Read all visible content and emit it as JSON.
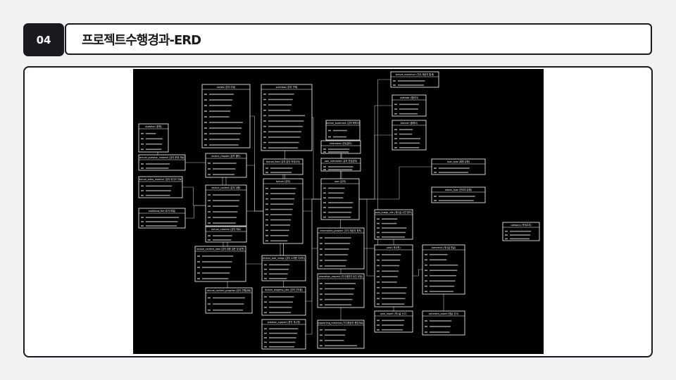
{
  "section_number": "04",
  "title": "프로젝트수행경과-ERD",
  "colors": {
    "number_box": "#1b1b1f",
    "frame_border": "#1b1b1f",
    "diagram_background": "#000000",
    "diagram_lines": "#ffffff"
  },
  "erd": {
    "entities": [
      "question (문제)",
      "lecture_question_material (강의 문제 자료)",
      "lecture_video_material (강의 비디오 자료)",
      "additional_file (추가 파일)",
      "review (강의 리뷰)",
      "lecture_chapter (강의 챕터)",
      "lecture_content (강의 내용)",
      "lecture_material (강의 자료)",
      "lecture_content_data (강의 내용 질문 및 답변)",
      "lecture_content_progress (강의 진행상태)",
      "purchase (강의 구매)",
      "lecture_field (강의 분야 카테고리)",
      "lecture (강의)",
      "lecture_side_image (강의 소개용 이미지)",
      "lecture_progress_rate (강의 진도율)",
      "question_support (문의 게시판)",
      "lecture_bookmark (강의 북마크)",
      "interested (관심분야)",
      "user_interested (유저 관심분야)",
      "user (유저)",
      "information_provider (지식 제공자 정보)",
      "promotion_request (지식제공자 승인 요청)",
      "supporting_materials (지식제공자 증빙자료)",
      "lecture_maximum (지식 제공자 통계)",
      "calendar (캘린더)",
      "planner (플래너)",
      "user_type (회원 유형)",
      "admin_type (관리자 유형)",
      "post_image_info (게시글 사진 정보)",
      "post (게시판)",
      "post_report (게시글 신고)",
      "comment (게시글 댓글)",
      "comment_report (댓글 신고)",
      "category (카테고리)"
    ]
  }
}
